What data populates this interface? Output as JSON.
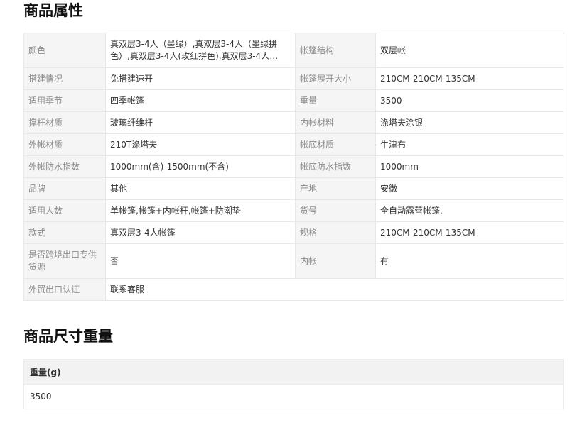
{
  "section1": {
    "title": "商品属性"
  },
  "attributes": [
    [
      {
        "k": "颜色",
        "v": "真双层3-4人（墨绿）,真双层3-4人（墨绿拼色）,真双层3-4人(玫红拼色),真双层3-4人（浅..."
      },
      {
        "k": "帐篷结构",
        "v": "双层帐"
      }
    ],
    [
      {
        "k": "搭建情况",
        "v": "免搭建速开"
      },
      {
        "k": "帐篷展开大小",
        "v": "210CM-210CM-135CM"
      }
    ],
    [
      {
        "k": "适用季节",
        "v": "四季帐篷"
      },
      {
        "k": "重量",
        "v": "3500"
      }
    ],
    [
      {
        "k": "撑杆材质",
        "v": "玻璃纤维杆"
      },
      {
        "k": "内帐材料",
        "v": "涤塔夫涂银"
      }
    ],
    [
      {
        "k": "外帐材质",
        "v": "210T涤塔夫"
      },
      {
        "k": "帐底材质",
        "v": "牛津布"
      }
    ],
    [
      {
        "k": "外帐防水指数",
        "v": "1000mm(含)-1500mm(不含)"
      },
      {
        "k": "帐底防水指数",
        "v": "1000mm"
      }
    ],
    [
      {
        "k": "品牌",
        "v": "其他"
      },
      {
        "k": "产地",
        "v": "安徽"
      }
    ],
    [
      {
        "k": "适用人数",
        "v": "单帐篷,帐篷+内帐杆,帐篷+防潮垫"
      },
      {
        "k": "货号",
        "v": "全自动露营帐篷."
      }
    ],
    [
      {
        "k": "款式",
        "v": "真双层3-4人帐篷"
      },
      {
        "k": "规格",
        "v": "210CM-210CM-135CM"
      }
    ],
    [
      {
        "k": "是否跨境出口专供货源",
        "v": "否"
      },
      {
        "k": "内帐",
        "v": "有"
      }
    ],
    [
      {
        "k": "外贸出口认证",
        "v": "联系客服"
      }
    ]
  ],
  "section2": {
    "title": "商品尺寸重量"
  },
  "size_table": {
    "header": "重量(g)",
    "value": "3500"
  }
}
